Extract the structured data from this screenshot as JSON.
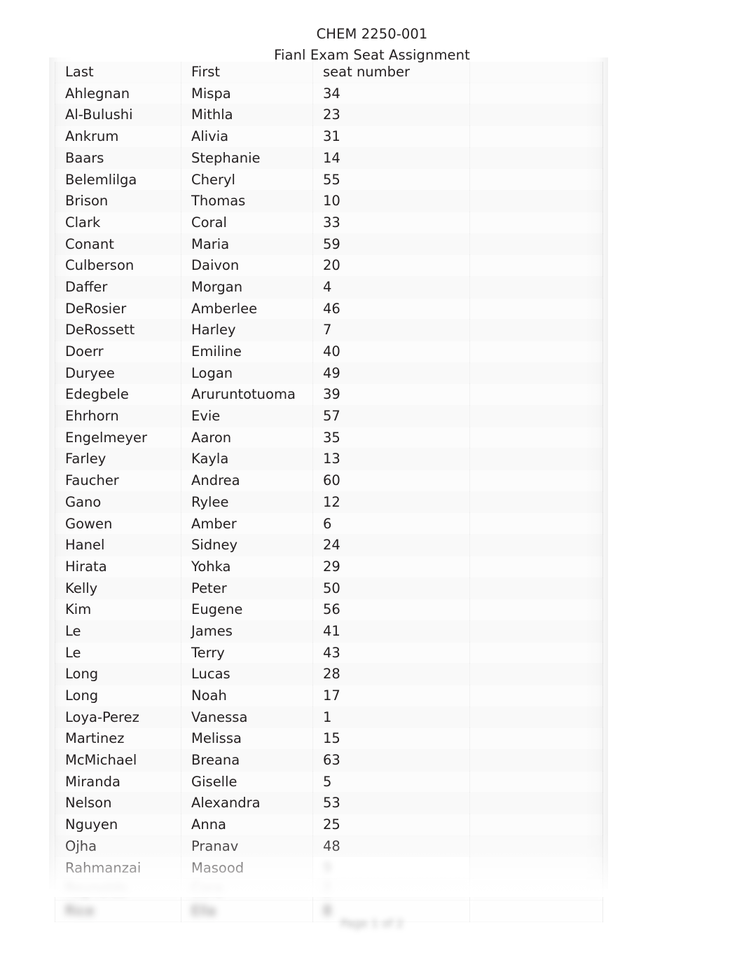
{
  "document": {
    "course_title": "CHEM 2250-001",
    "subtitle": "Fianl Exam Seat Assignment",
    "footer": "Page 1 of 2"
  },
  "table": {
    "columns": [
      "Last",
      "First",
      "seat number",
      ""
    ],
    "headers": {
      "last": "Last",
      "first": "First",
      "seat_number": "seat number",
      "blank": ""
    },
    "rows": [
      {
        "last": "Ahlegnan",
        "first": "Mispa",
        "seat": "34"
      },
      {
        "last": "Al-Bulushi",
        "first": "Mithla",
        "seat": "23"
      },
      {
        "last": "Ankrum",
        "first": "Alivia",
        "seat": "31"
      },
      {
        "last": "Baars",
        "first": "Stephanie",
        "seat": "14"
      },
      {
        "last": "Belemlilga",
        "first": "Cheryl",
        "seat": "55"
      },
      {
        "last": "Brison",
        "first": "Thomas",
        "seat": "10"
      },
      {
        "last": "Clark",
        "first": "Coral",
        "seat": "33"
      },
      {
        "last": "Conant",
        "first": "Maria",
        "seat": "59"
      },
      {
        "last": "Culberson",
        "first": "Daivon",
        "seat": "20"
      },
      {
        "last": "Daffer",
        "first": "Morgan",
        "seat": "4"
      },
      {
        "last": "DeRosier",
        "first": "Amberlee",
        "seat": "46"
      },
      {
        "last": "DeRossett",
        "first": "Harley",
        "seat": "7"
      },
      {
        "last": "Doerr",
        "first": "Emiline",
        "seat": "40"
      },
      {
        "last": "Duryee",
        "first": "Logan",
        "seat": "49"
      },
      {
        "last": "Edegbele",
        "first": "Aruruntotuoma",
        "seat": "39"
      },
      {
        "last": "Ehrhorn",
        "first": "Evie",
        "seat": "57"
      },
      {
        "last": "Engelmeyer",
        "first": "Aaron",
        "seat": "35"
      },
      {
        "last": "Farley",
        "first": "Kayla",
        "seat": "13"
      },
      {
        "last": "Faucher",
        "first": "Andrea",
        "seat": "60"
      },
      {
        "last": "Gano",
        "first": "Rylee",
        "seat": "12"
      },
      {
        "last": "Gowen",
        "first": "Amber",
        "seat": "6"
      },
      {
        "last": "Hanel",
        "first": "Sidney",
        "seat": "24"
      },
      {
        "last": "Hirata",
        "first": "Yohka",
        "seat": "29"
      },
      {
        "last": "Kelly",
        "first": "Peter",
        "seat": "50"
      },
      {
        "last": "Kim",
        "first": "Eugene",
        "seat": "56"
      },
      {
        "last": "Le",
        "first": "James",
        "seat": "41"
      },
      {
        "last": "Le",
        "first": "Terry",
        "seat": "43"
      },
      {
        "last": "Long",
        "first": "Lucas",
        "seat": "28"
      },
      {
        "last": "Long",
        "first": "Noah",
        "seat": "17"
      },
      {
        "last": "Loya-Perez",
        "first": "Vanessa",
        "seat": "1"
      },
      {
        "last": "Martinez",
        "first": "Melissa",
        "seat": "15"
      },
      {
        "last": "McMichael",
        "first": "Breana",
        "seat": "63"
      },
      {
        "last": "Miranda",
        "first": "Giselle",
        "seat": "5"
      },
      {
        "last": "Nelson",
        "first": "Alexandra",
        "seat": "53"
      },
      {
        "last": "Nguyen",
        "first": "Anna",
        "seat": "25"
      },
      {
        "last": "Ojha",
        "first": "Pranav",
        "seat": "48"
      },
      {
        "last": "Rahmanzai",
        "first": "Masood",
        "seat": "9"
      }
    ],
    "obscured_rows": [
      {
        "last": "Reynolds",
        "first": "Cora",
        "seat": "2"
      },
      {
        "last": "Rice",
        "first": "Ella",
        "seat": "8"
      }
    ]
  }
}
